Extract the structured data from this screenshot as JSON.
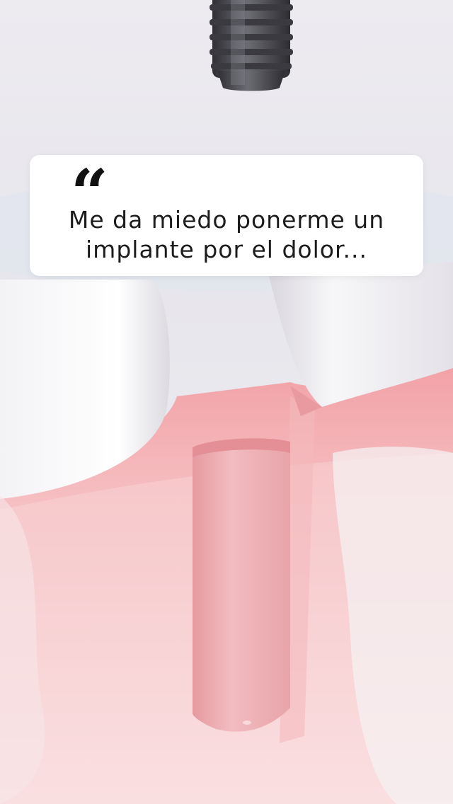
{
  "quote": {
    "icon": "quote-open-icon",
    "glyph": "“",
    "text": "Me da miedo ponerme un implante por el dolor..."
  },
  "colors": {
    "background": "#eae8ee",
    "gum": "#f3b3b6",
    "gum_light": "#fbe2e3",
    "tooth": "#f6f5f7",
    "implant": "#4a4a50",
    "socket": "#eba8ad",
    "card": "#ffffff",
    "text": "#1c1c1c"
  }
}
